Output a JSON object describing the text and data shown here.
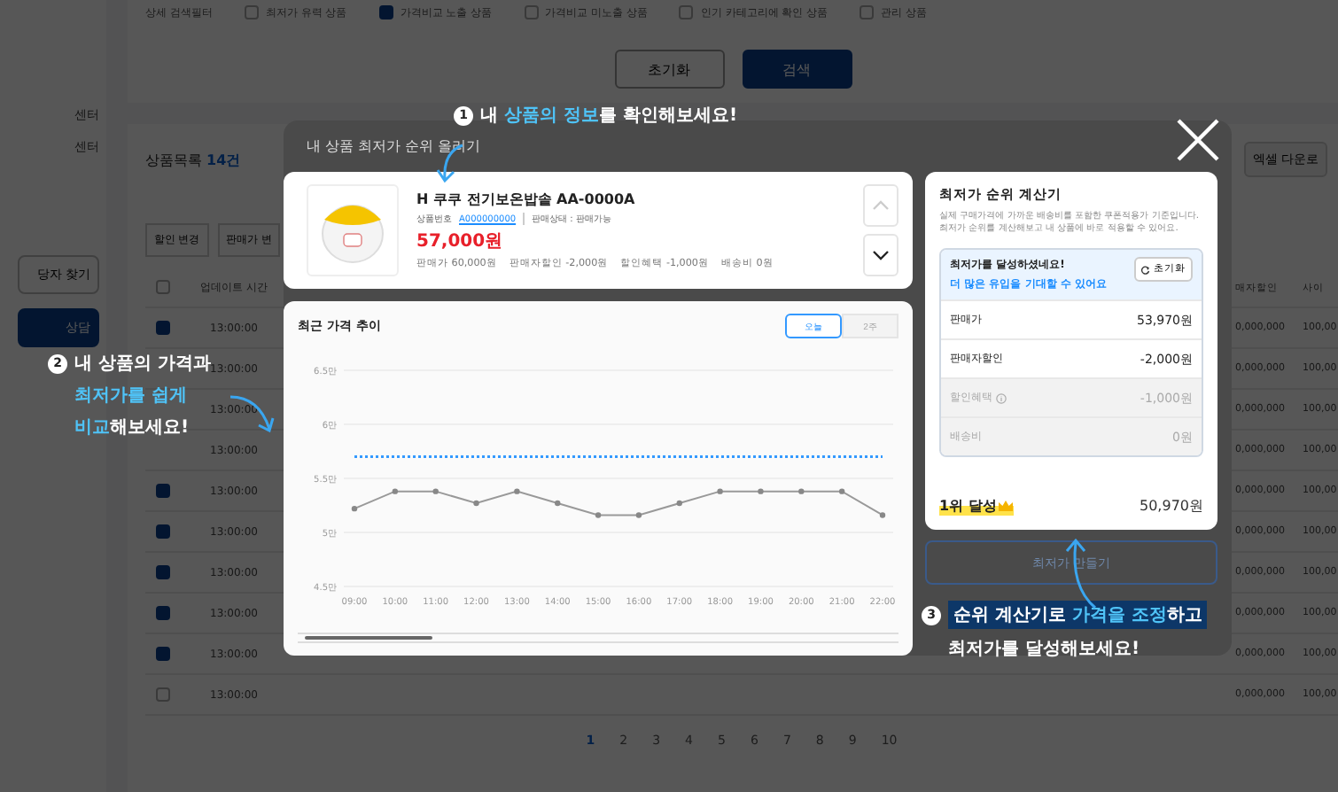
{
  "filter": {
    "label": "상세 검색필터",
    "options": [
      {
        "label": "최저가 유력 상품",
        "checked": false
      },
      {
        "label": "가격비교 노출 상품",
        "checked": true
      },
      {
        "label": "가격비교 미노출 상품",
        "checked": false
      },
      {
        "label": "인기 카테고리에 확인 상품",
        "checked": false
      },
      {
        "label": "관리 상품",
        "checked": false
      }
    ],
    "buttons": [
      {
        "label": "초기화",
        "kind": "outline"
      },
      {
        "label": "검색",
        "kind": "primary"
      }
    ]
  },
  "sidebar": {
    "items": [
      "센터",
      "센터"
    ],
    "buttons": [
      {
        "label": "당자 찾기",
        "kind": "outline"
      },
      {
        "label": "상담",
        "kind": "primary"
      }
    ]
  },
  "list": {
    "title": "상품목록",
    "count": "14건",
    "actions": [
      "할인 변경",
      "판매가 변"
    ],
    "excel": "엑셀 다운로",
    "header_checked": false,
    "columns": [
      "업데이트 시간",
      "매자할인",
      "사이"
    ],
    "rows": [
      {
        "time": "13:00:00",
        "checked": true,
        "col_2": "0,000,000",
        "col_3": "100,00"
      },
      {
        "time": "13:00:00",
        "col_2": "0,000,000",
        "col_3": "100,00"
      },
      {
        "time": "13:00:00",
        "col_2": "0,000,000",
        "col_3": "100,00"
      },
      {
        "time": "13:00:00",
        "col_2": "0,000,000",
        "col_3": "100,00"
      },
      {
        "time": "13:00:00",
        "checked": true,
        "col_2": "0,000,000",
        "col_3": "100,00"
      },
      {
        "time": "13:00:00",
        "checked": true,
        "col_2": "0,000,000",
        "col_3": "100,00"
      },
      {
        "time": "13:00:00",
        "checked": true,
        "col_2": "0,000,000",
        "col_3": "100,00"
      },
      {
        "time": "13:00:00",
        "checked": true,
        "col_2": "0,000,000",
        "col_3": "100,00"
      },
      {
        "time": "13:00:00",
        "checked": true,
        "col_2": "0,000,000",
        "col_3": "100,00"
      },
      {
        "time": "13:00:00",
        "checked": false,
        "col_2": "0,000,000",
        "col_3": "100,00"
      }
    ],
    "pages": [
      {
        "label": "1",
        "selected": true
      },
      {
        "label": "2",
        "selected": false
      },
      {
        "label": "3",
        "selected": false
      },
      {
        "label": "4",
        "selected": false
      },
      {
        "label": "5",
        "selected": false
      },
      {
        "label": "6",
        "selected": false
      },
      {
        "label": "7",
        "selected": false
      },
      {
        "label": "8",
        "selected": false
      },
      {
        "label": "9",
        "selected": false
      },
      {
        "label": "10",
        "selected": false
      }
    ]
  },
  "modal": {
    "title": "내 상품 최저가 순위 올리기",
    "product": {
      "name": "H 쿠쿠 전기보온밥솥 AA-0000A",
      "number_label": "상품번호",
      "number": "A000000000",
      "status": "판매상태 : 판매가능",
      "price": "57,000원",
      "details": [
        "판매가 60,000원",
        "판매자할인 -2,000원",
        "할인혜택 -1,000원",
        "배송비 0원"
      ],
      "up_disabled": true,
      "down_disabled": false
    },
    "chart": {
      "title": "최근 가격 추이",
      "periods": [
        {
          "label": "오늘",
          "selected": true
        },
        {
          "label": "2주",
          "selected": false
        }
      ],
      "chart_data": {
        "type": "line",
        "grid": true,
        "categories": [
          "09:00",
          "10:00",
          "11:00",
          "12:00",
          "13:00",
          "14:00",
          "15:00",
          "16:00",
          "17:00",
          "18:00",
          "19:00",
          "20:00",
          "21:00",
          "22:00"
        ],
        "ylim": [
          4.5,
          6.5
        ],
        "yticks": [
          {
            "value": 4.5,
            "label": "4.5만"
          },
          {
            "value": 5,
            "label": "5만"
          },
          {
            "value": 5.5,
            "label": "5.5만"
          },
          {
            "value": 6,
            "label": "6만"
          },
          {
            "value": 6.5,
            "label": "6.5만"
          }
        ],
        "series": [
          {
            "color": "#999999",
            "line_style": "solid",
            "marker": "circle",
            "values": [
              5.22,
              5.38,
              5.38,
              5.27,
              5.38,
              5.27,
              5.16,
              5.16,
              5.27,
              5.38,
              5.38,
              5.38,
              5.38,
              5.16
            ]
          },
          {
            "color": "#3399ff",
            "line_style": "dotted",
            "values": [
              5.7,
              5.7,
              5.7,
              5.7,
              5.7,
              5.7,
              5.7,
              5.7,
              5.7,
              5.7,
              5.7,
              5.7,
              5.7,
              5.7
            ]
          }
        ]
      }
    },
    "calculator": {
      "title": "최저가 순위 계산기",
      "description": "실제 구매가격에 가까운 배송비를 포함한 쿠폰적용가 기준입니다. 최저가 순위를 계산해보고 내 상품에 바로 적용할 수 있어요.",
      "banner_title": "최저가를 달성하셨네요!",
      "banner_subtitle": "더 많은 유입을 기대할 수 있어요",
      "reset": "초기화",
      "rows": [
        {
          "label": "판매가",
          "value": "53,970원",
          "disabled": false,
          "info": false
        },
        {
          "label": "판매자할인",
          "value": "-2,000원",
          "disabled": false,
          "info": false
        },
        {
          "label": "할인혜택",
          "value": "-1,000원",
          "disabled": true,
          "info": true
        },
        {
          "label": "배송비",
          "value": "0원",
          "disabled": true,
          "info": false
        }
      ],
      "rank": "1위 달성",
      "total": "50,970원"
    },
    "make_button": "최저가 만들기"
  },
  "callouts": [
    {
      "number": "1",
      "lines": [
        "내 **상품의 정보**를 확인해보세요!"
      ]
    },
    {
      "number": "2",
      "lines": [
        "내 상품의 가격과",
        "**최저가를 쉽게**",
        "**비교**해보세요!"
      ]
    },
    {
      "number": "3",
      "lines": [
        "순위 계산기로 **가격을 조정**하고",
        "최저가를 달성해보세요!"
      ]
    }
  ]
}
